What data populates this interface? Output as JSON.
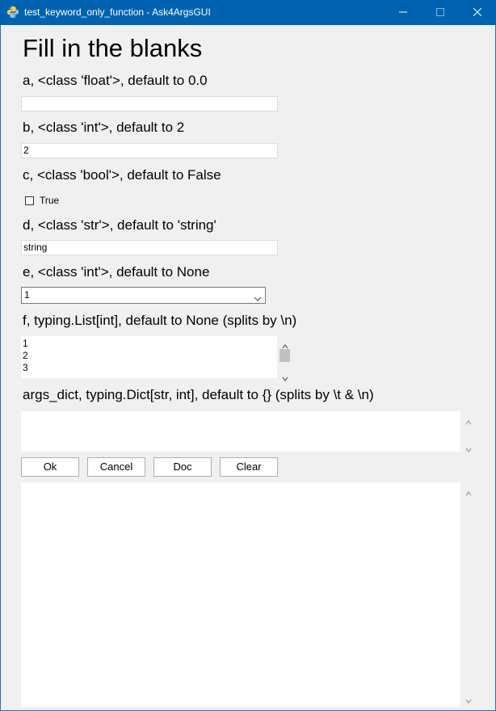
{
  "window": {
    "title": "test_keyword_only_function - Ask4ArgsGUI"
  },
  "icons": {
    "app": "python-icon",
    "minimize": "minimize-icon",
    "maximize": "maximize-icon",
    "close": "close-icon"
  },
  "colors": {
    "titlebar": "#0063b1",
    "background": "#f0f0f0"
  },
  "form": {
    "heading": "Fill in the blanks",
    "fields": {
      "a": {
        "label": "a, <class 'float'>, default to 0.0",
        "value": ""
      },
      "b": {
        "label": "b, <class 'int'>, default to 2",
        "value": "2"
      },
      "c": {
        "label": "c, <class 'bool'>, default to False",
        "checkbox_label": "True",
        "checked": false
      },
      "d": {
        "label": "d, <class 'str'>, default to 'string'",
        "value": "string"
      },
      "e": {
        "label": "e, <class 'int'>, default to None",
        "selected": "1"
      },
      "f": {
        "label": "f, typing.List[int], default to None (splits by \\n)",
        "items": [
          "1",
          "2",
          "3"
        ]
      },
      "args_dict": {
        "label": "args_dict, typing.Dict[str, int], default to {} (splits by \\t & \\n)",
        "value": ""
      }
    }
  },
  "buttons": {
    "ok": "Ok",
    "cancel": "Cancel",
    "doc": "Doc",
    "clear": "Clear"
  },
  "output": {
    "text": ""
  }
}
